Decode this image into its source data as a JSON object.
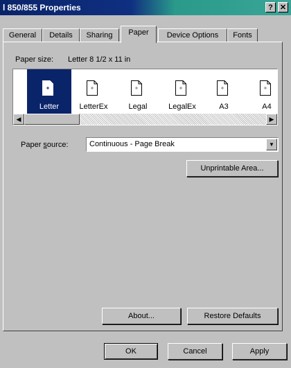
{
  "window": {
    "title": "l 850/855 Properties",
    "help": "?",
    "close": "✕"
  },
  "tabs": [
    {
      "label": "General"
    },
    {
      "label": "Details"
    },
    {
      "label": "Sharing"
    },
    {
      "label": "Paper"
    },
    {
      "label": "Device Options"
    },
    {
      "label": "Fonts"
    }
  ],
  "active_tab": "Paper",
  "paper_size": {
    "label": "Paper size:",
    "value": "Letter 8 1/2 x 11 in"
  },
  "paper_list": [
    {
      "label": "Letter",
      "selected": true
    },
    {
      "label": "LetterEx",
      "selected": false
    },
    {
      "label": "Legal",
      "selected": false
    },
    {
      "label": "LegalEx",
      "selected": false
    },
    {
      "label": "A3",
      "selected": false
    },
    {
      "label": "A4",
      "selected": false
    }
  ],
  "paper_source": {
    "label": "Paper source:",
    "value": "Continuous - Page Break"
  },
  "buttons": {
    "unprintable": "Unprintable Area...",
    "about": "About...",
    "restore": "Restore Defaults",
    "ok": "OK",
    "cancel": "Cancel",
    "apply": "Apply"
  },
  "colors": {
    "selection": "#0a246a",
    "face": "#c0c0c0"
  }
}
